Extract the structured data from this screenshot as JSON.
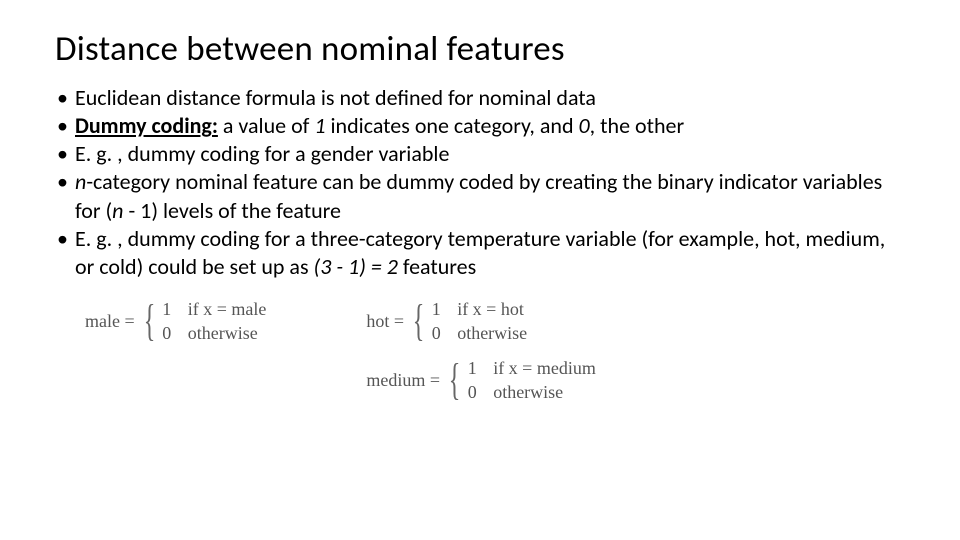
{
  "title": "Distance between nominal features",
  "bullets": {
    "b1": "Euclidean distance formula is not defined for nominal data",
    "b2_pre": "Dummy coding:",
    "b2_mid1": " a value of ",
    "b2_v1": "1",
    "b2_mid2": " indicates one category, and ",
    "b2_v0": "0",
    "b2_end": ", the other",
    "b3": "E. g. , dummy coding for a gender variable",
    "b4_n": "n",
    "b4_mid": "-category nominal feature can be dummy coded by creating the binary indicator variables for (",
    "b4_n2": "n",
    "b4_end": " - 1) levels of the feature",
    "b5_pre": "E. g. , dummy coding for a three-category temperature variable (for example, hot, medium, or cold) could be set up as ",
    "b5_expr": "(3 - 1) = 2",
    "b5_end": " features"
  },
  "formulas": {
    "male": {
      "lhs": "male =",
      "c1v": "1",
      "c1t": "if x = male",
      "c0v": "0",
      "c0t": "otherwise"
    },
    "hot": {
      "lhs": "hot =",
      "c1v": "1",
      "c1t": "if x = hot",
      "c0v": "0",
      "c0t": "otherwise"
    },
    "medium": {
      "lhs": "medium =",
      "c1v": "1",
      "c1t": "if x = medium",
      "c0v": "0",
      "c0t": "otherwise"
    }
  }
}
